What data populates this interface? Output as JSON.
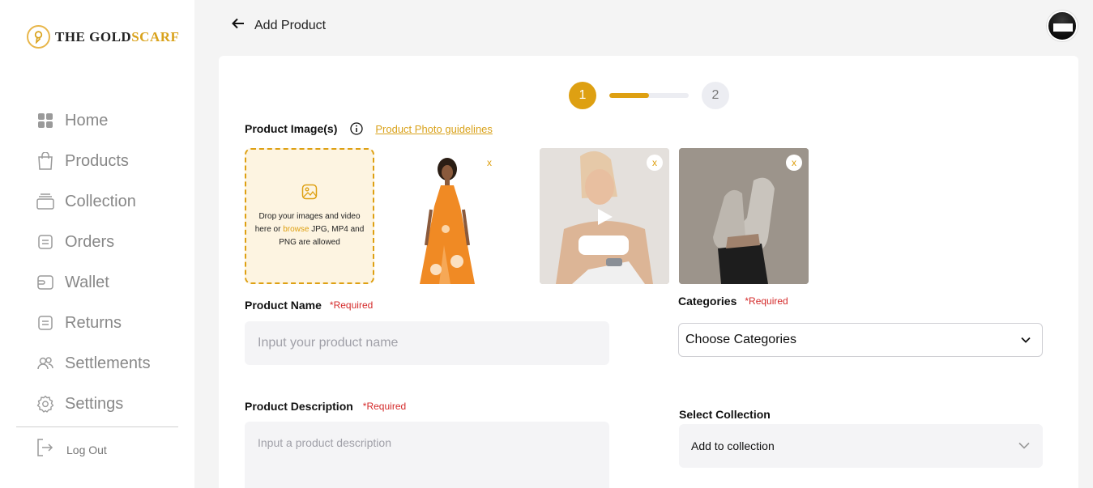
{
  "brand": {
    "name_part1": "THE GOLD",
    "name_part2": "SCARF"
  },
  "sidebar": {
    "items": [
      {
        "label": "Home",
        "icon": "grid-icon"
      },
      {
        "label": "Products",
        "icon": "shopping-bag-icon"
      },
      {
        "label": "Collection",
        "icon": "stack-icon"
      },
      {
        "label": "Orders",
        "icon": "receipt-icon"
      },
      {
        "label": "Wallet",
        "icon": "wallet-icon"
      },
      {
        "label": "Returns",
        "icon": "returns-icon"
      },
      {
        "label": "Settlements",
        "icon": "users-icon"
      },
      {
        "label": "Settings",
        "icon": "gear-icon"
      }
    ],
    "logout_label": "Log Out"
  },
  "header": {
    "title": "Add Product"
  },
  "stepper": {
    "step1": "1",
    "step2": "2",
    "progress": 0.5
  },
  "images": {
    "title": "Product Image(s)",
    "guidelines_link": "Product Photo guidelines",
    "dropzone_line_pre": "Drop your images and video here or ",
    "dropzone_browse": "browse",
    "dropzone_line_post": " JPG, MP4 and PNG are allowed",
    "remove_label": "x"
  },
  "product_name": {
    "label": "Product Name",
    "required": "*Required",
    "placeholder": "Input your product name"
  },
  "product_description": {
    "label": "Product Description",
    "required": "*Required",
    "placeholder": "Input a product description"
  },
  "categories": {
    "label": "Categories",
    "required": "*Required",
    "selected": "Choose Categories"
  },
  "collection": {
    "label": "Select Collection",
    "selected": "Add to collection"
  },
  "colors": {
    "accent": "#dea012",
    "required": "#d42a2a"
  }
}
